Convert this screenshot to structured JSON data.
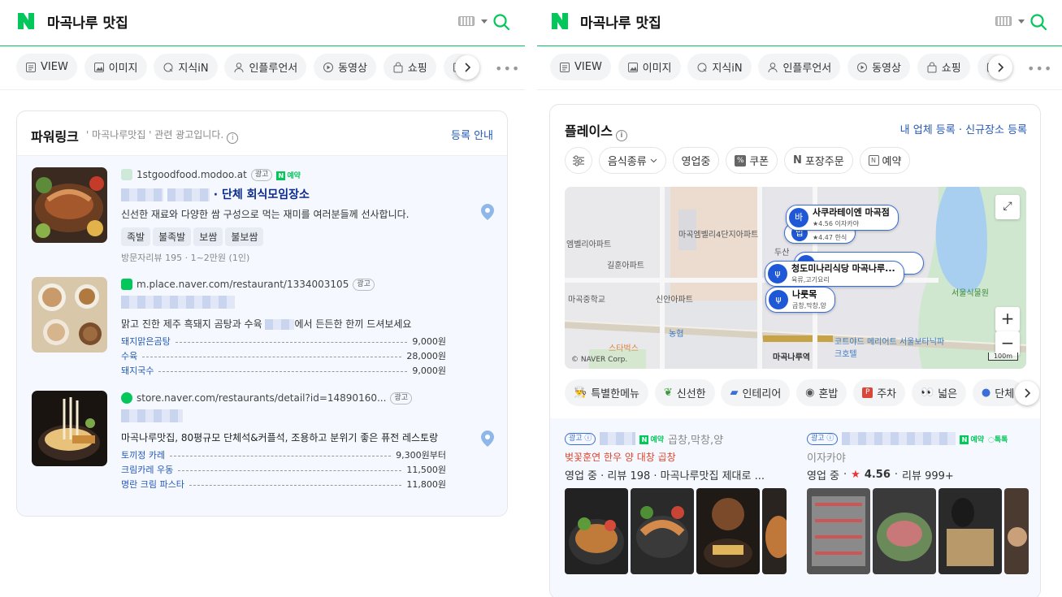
{
  "search": {
    "query": "마곡나루 맛집"
  },
  "tabs": [
    {
      "label": "VIEW",
      "icon": "view-icon"
    },
    {
      "label": "이미지",
      "icon": "image-icon"
    },
    {
      "label": "지식iN",
      "icon": "q-icon"
    },
    {
      "label": "인플루언서",
      "icon": "person-icon"
    },
    {
      "label": "동영상",
      "icon": "play-icon"
    },
    {
      "label": "쇼핑",
      "icon": "bag-icon"
    }
  ],
  "powerlink": {
    "title": "파워링크",
    "subtitle": "' 마곡나루맛집 ' 관련 광고입니다.",
    "register_label": "등록 안내",
    "ads": [
      {
        "url": "1stgoodfood.modoo.at",
        "badge": "광고",
        "reserve": "예약",
        "title": "· 단체 회식모임장소",
        "desc": "신선한 재료와 다양한 쌈 구성으로 먹는 재미를 여러분들께 선사합니다.",
        "chips": [
          "족발",
          "불족발",
          "보쌈",
          "불보쌈"
        ],
        "meta": "방문자리뷰 195 · 1~2만원 (1인)"
      },
      {
        "url": "m.place.naver.com/restaurant/1334003105",
        "badge": "광고",
        "desc_a": "맑고 진한 제주 흑돼지 곰탕과 수육",
        "desc_b": "에서 든든한 한끼 드셔보세요",
        "menu": [
          {
            "name": "돼지맑은곰탕",
            "price": "9,000원"
          },
          {
            "name": "수육",
            "price": "28,000원"
          },
          {
            "name": "돼지국수",
            "price": "9,000원"
          }
        ]
      },
      {
        "url": "store.naver.com/restaurants/detail?id=14890160...",
        "badge": "광고",
        "desc": "마곡나루맛집, 80평규모 단체석&커플석, 조용하고 분위기 좋은 퓨전 레스토랑",
        "menu": [
          {
            "name": "토끼정 카레",
            "price": "9,300원부터"
          },
          {
            "name": "크림카레 우동",
            "price": "11,500원"
          },
          {
            "name": "명란 크림 파스타",
            "price": "11,800원"
          }
        ]
      }
    ]
  },
  "place": {
    "title": "플레이스",
    "register_label": "내 업체 등록 · 신규장소 등록",
    "filters": [
      "음식종류",
      "영업중",
      "쿠폰",
      "포장주문",
      "예약"
    ],
    "map": {
      "pins": [
        {
          "name": "사쿠라테이엔 마곡점",
          "sub": "★4.56 이자카야",
          "icon": "바"
        },
        {
          "name": "",
          "sub": "★4.47 한식",
          "icon": "밥"
        },
        {
          "name": "청도미나리식당 마곡나루...",
          "sub": "육류,고기요리",
          "icon": "ψ"
        },
        {
          "name": "나룻목",
          "sub": "곱창,막창,양",
          "icon": "ψ"
        }
      ],
      "labels": [
        "마곡엠벨리4단지아파트",
        "엠벨리아파트",
        "길훈아파트",
        "마곡중학교",
        "신안아파트",
        "스타벅스",
        "농협",
        "마곡나루역",
        "코트야드 메리어트 서울보타닉파크호텔",
        "서울식물원",
        "두산"
      ],
      "copyright": "© NAVER Corp.",
      "scale": "100m",
      "zoom_in": "+",
      "zoom_out": "−"
    },
    "features": [
      "특별한메뉴",
      "신선한",
      "인테리어",
      "혼밥",
      "주차",
      "넓은",
      "단체"
    ],
    "items": [
      {
        "badge": "광고",
        "reserve": "예약",
        "category": "곱창,막창,양",
        "promo": "벚꽃훈연 한우 양 대창 곱창",
        "line": "영업 중 · 리뷰 198 · 마곡나루맛집 제대로 ..."
      },
      {
        "badge": "광고",
        "reserve": "예약",
        "talk": "톡톡",
        "category": "이자카야",
        "status": "영업 중",
        "rating": "4.56",
        "reviews": "리뷰 999+"
      }
    ]
  }
}
